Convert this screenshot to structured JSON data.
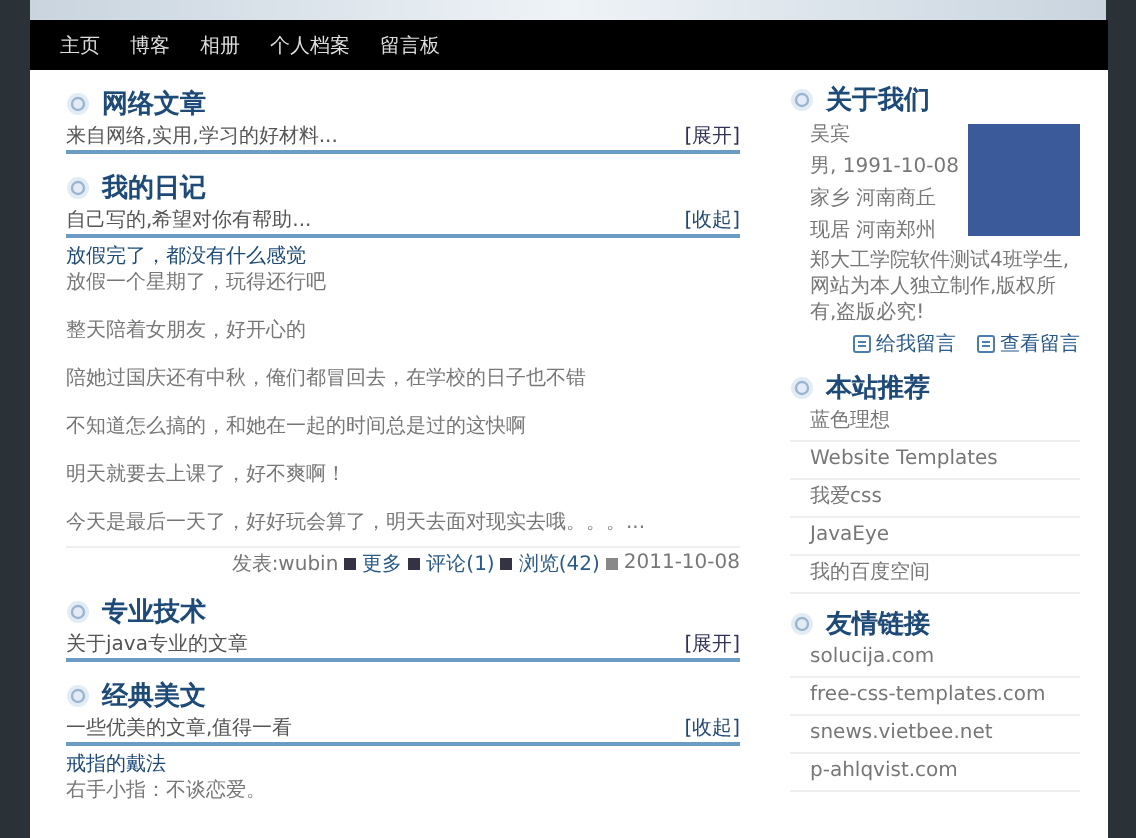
{
  "nav": {
    "items": [
      {
        "label": "主页"
      },
      {
        "label": "博客"
      },
      {
        "label": "相册"
      },
      {
        "label": "个人档案"
      },
      {
        "label": "留言板"
      }
    ]
  },
  "sections": [
    {
      "title": "网络文章",
      "subtitle": "来自网络,实用,学习的好材料...",
      "toggle": "[展开]",
      "expanded": false
    },
    {
      "title": "我的日记",
      "subtitle": "自己写的,希望对你有帮助...",
      "toggle": "[收起]",
      "expanded": true,
      "posts": [
        {
          "title": "放假完了，都没有什么感觉",
          "paragraphs": [
            "放假一个星期了，玩得还行吧",
            "整天陪着女朋友，好开心的",
            "陪她过国庆还有中秋，俺们都冒回去，在学校的日子也不错",
            "不知道怎么搞的，和她在一起的时间总是过的这快啊",
            "明天就要去上课了，好不爽啊！",
            "今天是最后一天了，好好玩会算了，明天去面对现实去哦。。。..."
          ],
          "meta": {
            "author": "发表:wubin",
            "more": "更多",
            "comments": "评论(1)",
            "views": "浏览(42)",
            "date": "2011-10-08"
          }
        }
      ]
    },
    {
      "title": "专业技术",
      "subtitle": "关于java专业的文章",
      "toggle": "[展开]",
      "expanded": false
    },
    {
      "title": "经典美文",
      "subtitle": "一些优美的文章,值得一看",
      "toggle": "[收起]",
      "expanded": true,
      "posts": [
        {
          "title": "戒指的戴法",
          "paragraphs": [
            "右手小指：不谈恋爱。"
          ]
        }
      ]
    }
  ],
  "about": {
    "title": "关于我们",
    "lines": [
      "吴宾",
      "男, 1991-10-08",
      "家乡 河南商丘",
      "现居 河南郑州"
    ],
    "description": "郑大工学院软件测试4班学生,网站为本人独立制作,版权所有,盗版必究!",
    "actions": [
      "给我留言",
      "查看留言"
    ]
  },
  "recommend": {
    "title": "本站推荐",
    "items": [
      "蓝色理想",
      "Website Templates",
      "我爱css",
      "JavaEye",
      "我的百度空间"
    ]
  },
  "links": {
    "title": "友情链接",
    "items": [
      "solucija.com",
      "free-css-templates.com",
      "snews.vietbee.net",
      "p-ahlqvist.com"
    ]
  }
}
